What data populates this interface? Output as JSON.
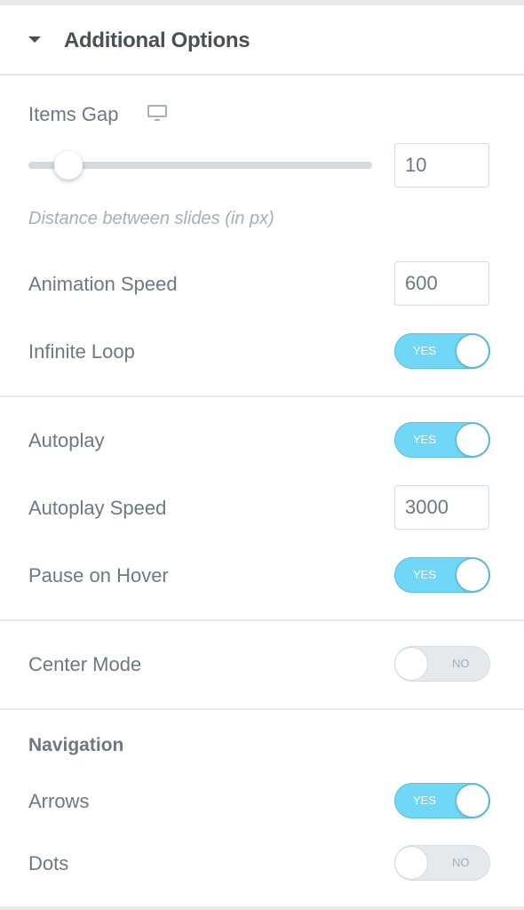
{
  "section": {
    "title": "Additional Options",
    "expanded": true
  },
  "items_gap": {
    "label": "Items Gap",
    "device_icon": "desktop-monitor-icon",
    "slider_value": 10,
    "slider_fraction": 0.1,
    "value": "10",
    "description": "Distance between slides (in px)"
  },
  "animation_speed": {
    "label": "Animation Speed",
    "value": "600"
  },
  "infinite_loop": {
    "label": "Infinite Loop",
    "state": "YES"
  },
  "autoplay": {
    "label": "Autoplay",
    "state": "YES"
  },
  "autoplay_speed": {
    "label": "Autoplay Speed",
    "value": "3000"
  },
  "pause_on_hover": {
    "label": "Pause on Hover",
    "state": "YES"
  },
  "center_mode": {
    "label": "Center Mode",
    "state": "NO"
  },
  "navigation": {
    "heading": "Navigation",
    "arrows": {
      "label": "Arrows",
      "state": "YES"
    },
    "dots": {
      "label": "Dots",
      "state": "NO"
    }
  },
  "colors": {
    "toggle_on": "#71d7f7",
    "toggle_off": "#e6e9ec",
    "text": "#6d7882",
    "heading": "#495157"
  }
}
